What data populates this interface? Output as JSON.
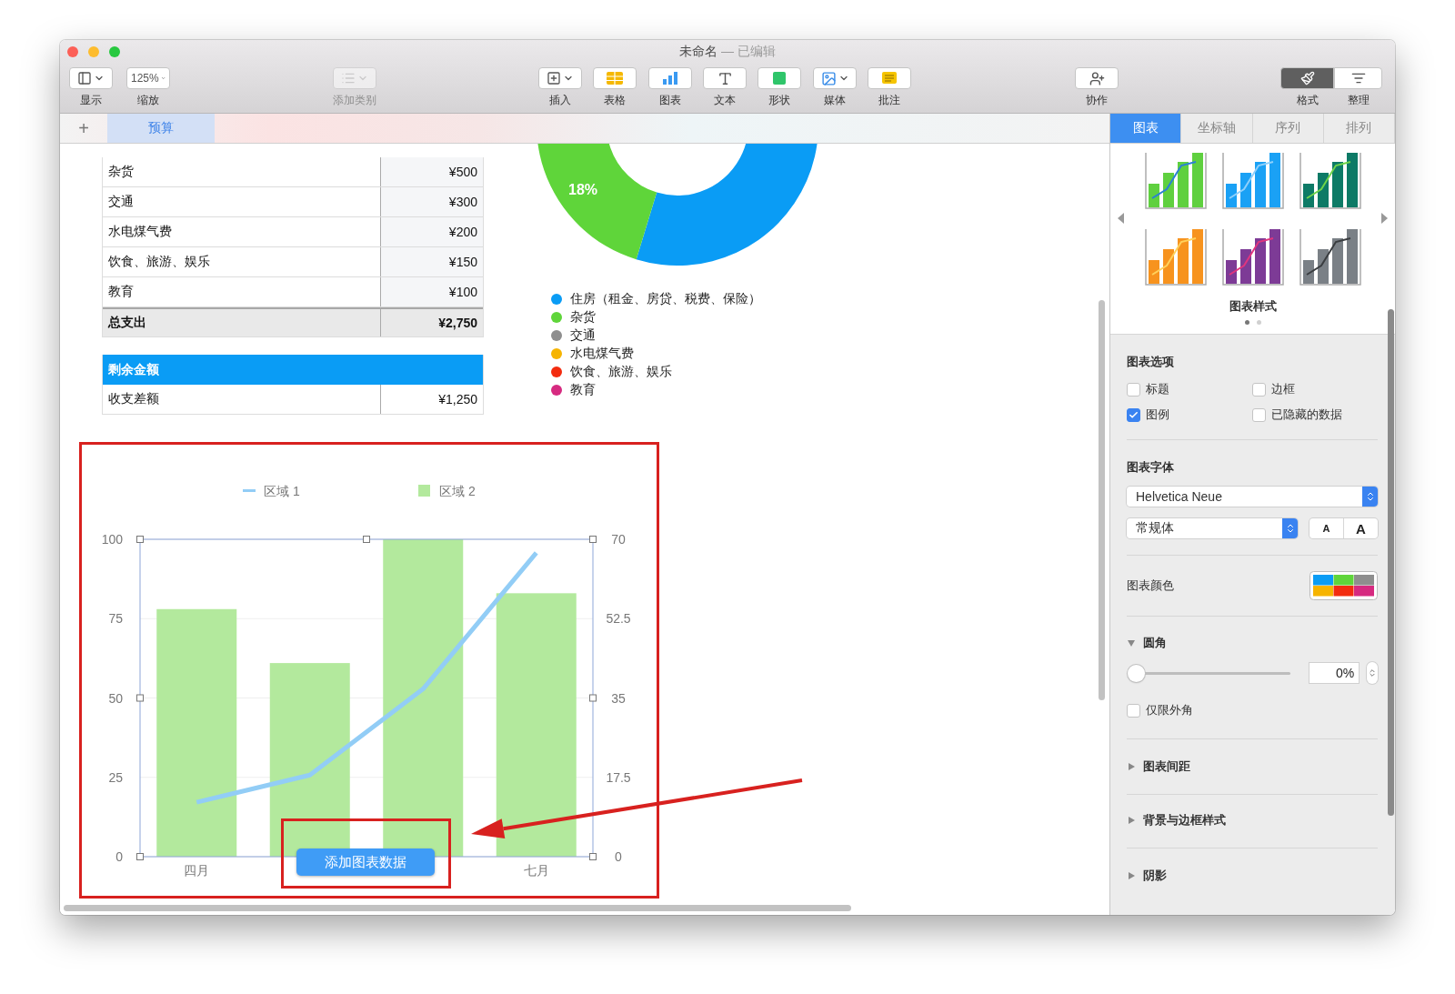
{
  "window": {
    "title": "未命名",
    "status": "— 已编辑"
  },
  "toolbar": [
    {
      "label": "显示",
      "kind": "dropdown",
      "disabled": false
    },
    {
      "label": "缩放",
      "kind": "dropdown",
      "value": "125%",
      "disabled": false
    },
    {
      "label": "添加类别",
      "kind": "dropdown",
      "disabled": true
    },
    {
      "label": "插入",
      "kind": "dropdown",
      "disabled": false
    },
    {
      "label": "表格",
      "kind": "button",
      "disabled": false
    },
    {
      "label": "图表",
      "kind": "button",
      "disabled": false
    },
    {
      "label": "文本",
      "kind": "button",
      "disabled": false
    },
    {
      "label": "形状",
      "kind": "button",
      "disabled": false
    },
    {
      "label": "媒体",
      "kind": "dropdown",
      "disabled": false
    },
    {
      "label": "批注",
      "kind": "button",
      "disabled": false
    },
    {
      "label": "协作",
      "kind": "button",
      "disabled": false
    },
    {
      "label": "格式",
      "kind": "segment",
      "selected": true,
      "disabled": false
    },
    {
      "label": "整理",
      "kind": "segment",
      "selected": false,
      "disabled": false
    }
  ],
  "sheet_tabs": {
    "add": "+",
    "tabs": [
      {
        "label": "预算",
        "selected": true
      }
    ]
  },
  "expenses_table": {
    "rows": [
      {
        "label": "杂货",
        "value": "¥500",
        "kind": "row"
      },
      {
        "label": "交通",
        "value": "¥300",
        "kind": "row"
      },
      {
        "label": "水电煤气费",
        "value": "¥200",
        "kind": "row"
      },
      {
        "label": "饮食、旅游、娱乐",
        "value": "¥150",
        "kind": "row"
      },
      {
        "label": "教育",
        "value": "¥100",
        "kind": "row"
      },
      {
        "label": "总支出",
        "value": "¥2,750",
        "kind": "total"
      }
    ]
  },
  "balance_table": {
    "header": "剩余金额",
    "rows": [
      {
        "label": "收支差额",
        "value": "¥1,250"
      }
    ]
  },
  "donut": {
    "label": "18%",
    "legend": [
      {
        "label": "住房（租金、房贷、税费、保险）",
        "color": "#0a9cf5"
      },
      {
        "label": "杂货",
        "color": "#5fd53a"
      },
      {
        "label": "交通",
        "color": "#8e8e8e"
      },
      {
        "label": "水电煤气费",
        "color": "#f6b400"
      },
      {
        "label": "饮食、旅游、娱乐",
        "color": "#f32c0f"
      },
      {
        "label": "教育",
        "color": "#d62a80"
      }
    ]
  },
  "chart": {
    "chart_data": {
      "type": "bar",
      "grid": true,
      "legend": true,
      "categories": [
        "四月",
        null,
        null,
        "七月"
      ],
      "ylim": [
        0,
        100
      ],
      "yticks": [
        0,
        25,
        50,
        75,
        100
      ],
      "y2lim": [
        0,
        70
      ],
      "y2ticks": [
        0,
        17.5,
        35,
        52.5,
        70
      ],
      "series": [
        {
          "name": "区域 1",
          "type": "line",
          "axis": "y2",
          "color": "#92cdf6",
          "values": [
            12,
            18,
            37,
            67
          ]
        },
        {
          "name": "区域 2",
          "type": "bar",
          "color": "#b3e99d",
          "values": [
            78,
            61,
            100,
            83
          ]
        }
      ]
    },
    "add_data_button": "添加图表数据"
  },
  "inspector": {
    "tabs": [
      {
        "label": "图表",
        "selected": true
      },
      {
        "label": "坐标轴",
        "selected": false
      },
      {
        "label": "序列",
        "selected": false
      },
      {
        "label": "排列",
        "selected": false
      }
    ],
    "style_caption": "图表样式",
    "style_pages": [
      {
        "selected": true
      },
      {
        "selected": false
      }
    ],
    "options": {
      "title": "图表选项",
      "checkboxes": [
        {
          "label": "标题",
          "checked": false
        },
        {
          "label": "边框",
          "checked": false
        },
        {
          "label": "图例",
          "checked": true
        },
        {
          "label": "已隐藏的数据",
          "checked": false
        }
      ]
    },
    "font": {
      "title": "图表字体",
      "family": "Helvetica Neue",
      "style": "常规体",
      "size_buttons": [
        "A",
        "A"
      ]
    },
    "colors": {
      "title": "图表颜色"
    },
    "corner": {
      "title": "圆角",
      "expanded": true,
      "level": 0,
      "value": "0%",
      "checkbox": {
        "label": "仅限外角",
        "checked": false
      }
    },
    "sections": [
      {
        "title": "图表间距",
        "expanded": false
      },
      {
        "title": "背景与边框样式",
        "expanded": false
      },
      {
        "title": "阴影",
        "expanded": false
      }
    ]
  }
}
